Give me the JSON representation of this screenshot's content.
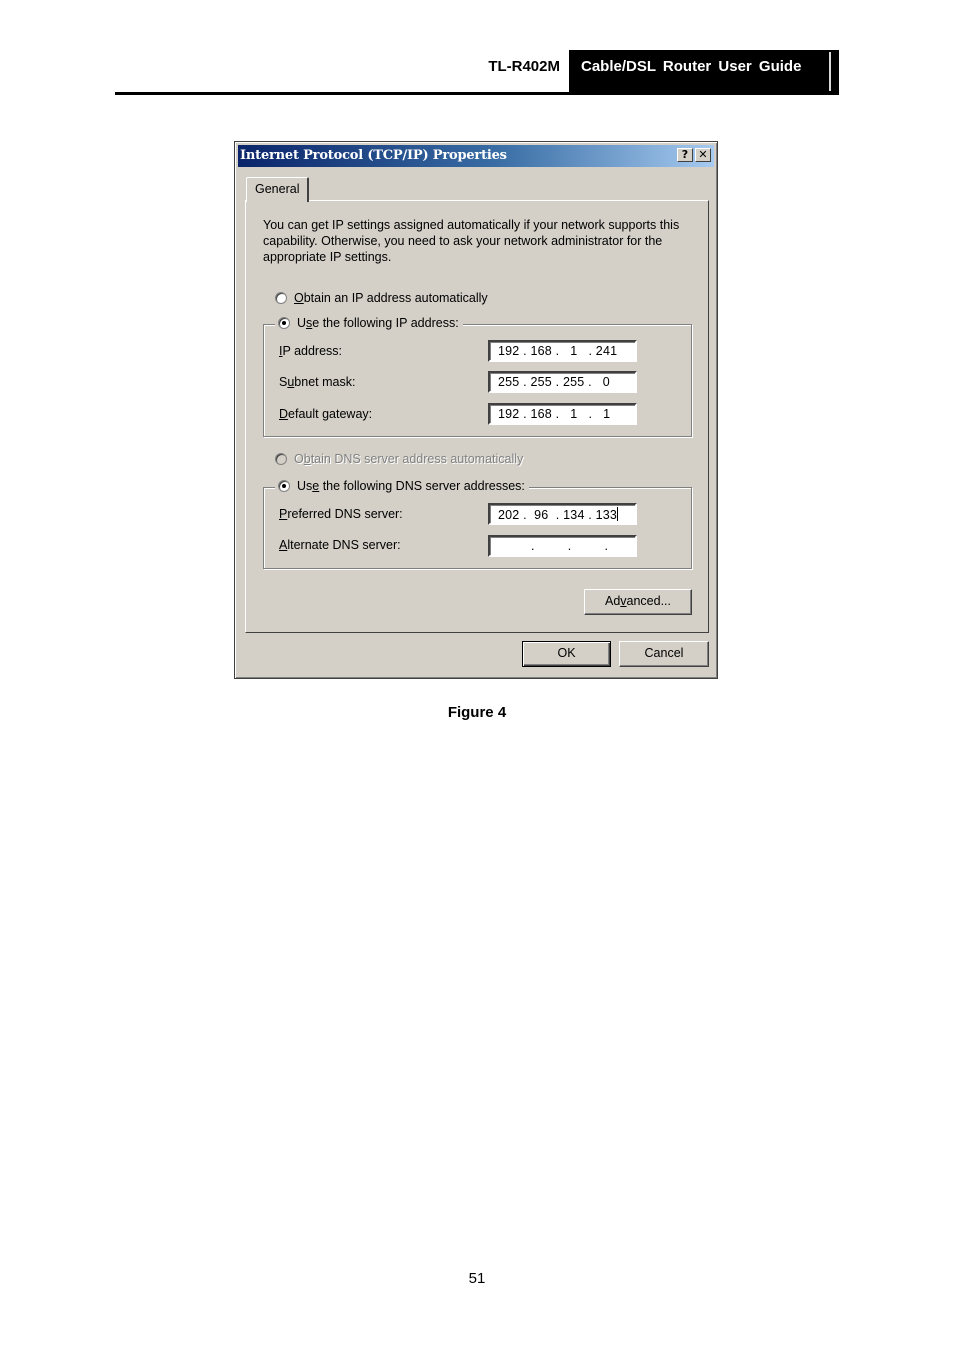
{
  "header": {
    "model": "TL-R402M",
    "guide_title": "Cable/DSL  Router  User  Guide"
  },
  "dialog": {
    "title": "Internet Protocol (TCP/IP) Properties",
    "help_button": "?",
    "close_button": "✕",
    "tabs": [
      {
        "label": "General",
        "active": true
      }
    ],
    "intro_text": "You can get IP settings assigned automatically if your network supports this capability. Otherwise, you need to ask your network administrator for the appropriate IP settings.",
    "ip_mode": {
      "auto": {
        "prefix": "",
        "accel": "O",
        "rest": "btain an IP address automatically",
        "checked": false
      },
      "manual": {
        "prefix": "U",
        "accel": "s",
        "rest": "e the following IP address:",
        "checked": true
      }
    },
    "ip_fields": [
      {
        "label_prefix": "",
        "accel": "I",
        "label_rest": "P address:",
        "value": "192 . 168 .   1   . 241"
      },
      {
        "label_prefix": "S",
        "accel": "u",
        "label_rest": "bnet mask:",
        "value": "255 . 255 . 255 .   0"
      },
      {
        "label_prefix": "",
        "accel": "D",
        "label_rest": "efault gateway:",
        "value": "192 . 168 .   1   .   1"
      }
    ],
    "dns_mode": {
      "auto": {
        "prefix": "O",
        "accel": "b",
        "rest": "tain DNS server address automatically",
        "checked": false,
        "disabled": true
      },
      "manual": {
        "prefix": "Us",
        "accel": "e",
        "rest": " the following DNS server addresses:",
        "checked": true
      }
    },
    "dns_fields": [
      {
        "label_prefix": "",
        "accel": "P",
        "label_rest": "referred DNS server:",
        "value": "202 .  96  . 134 . 133",
        "focused": true
      },
      {
        "label_prefix": "",
        "accel": "A",
        "label_rest": "lternate DNS server:",
        "value": "         .         .         .",
        "focused": false
      }
    ],
    "advanced_button": {
      "prefix": "Ad",
      "accel": "v",
      "rest": "anced..."
    },
    "ok_button": "OK",
    "cancel_button": "Cancel"
  },
  "figure_caption": "Figure 4",
  "page_number": "51"
}
